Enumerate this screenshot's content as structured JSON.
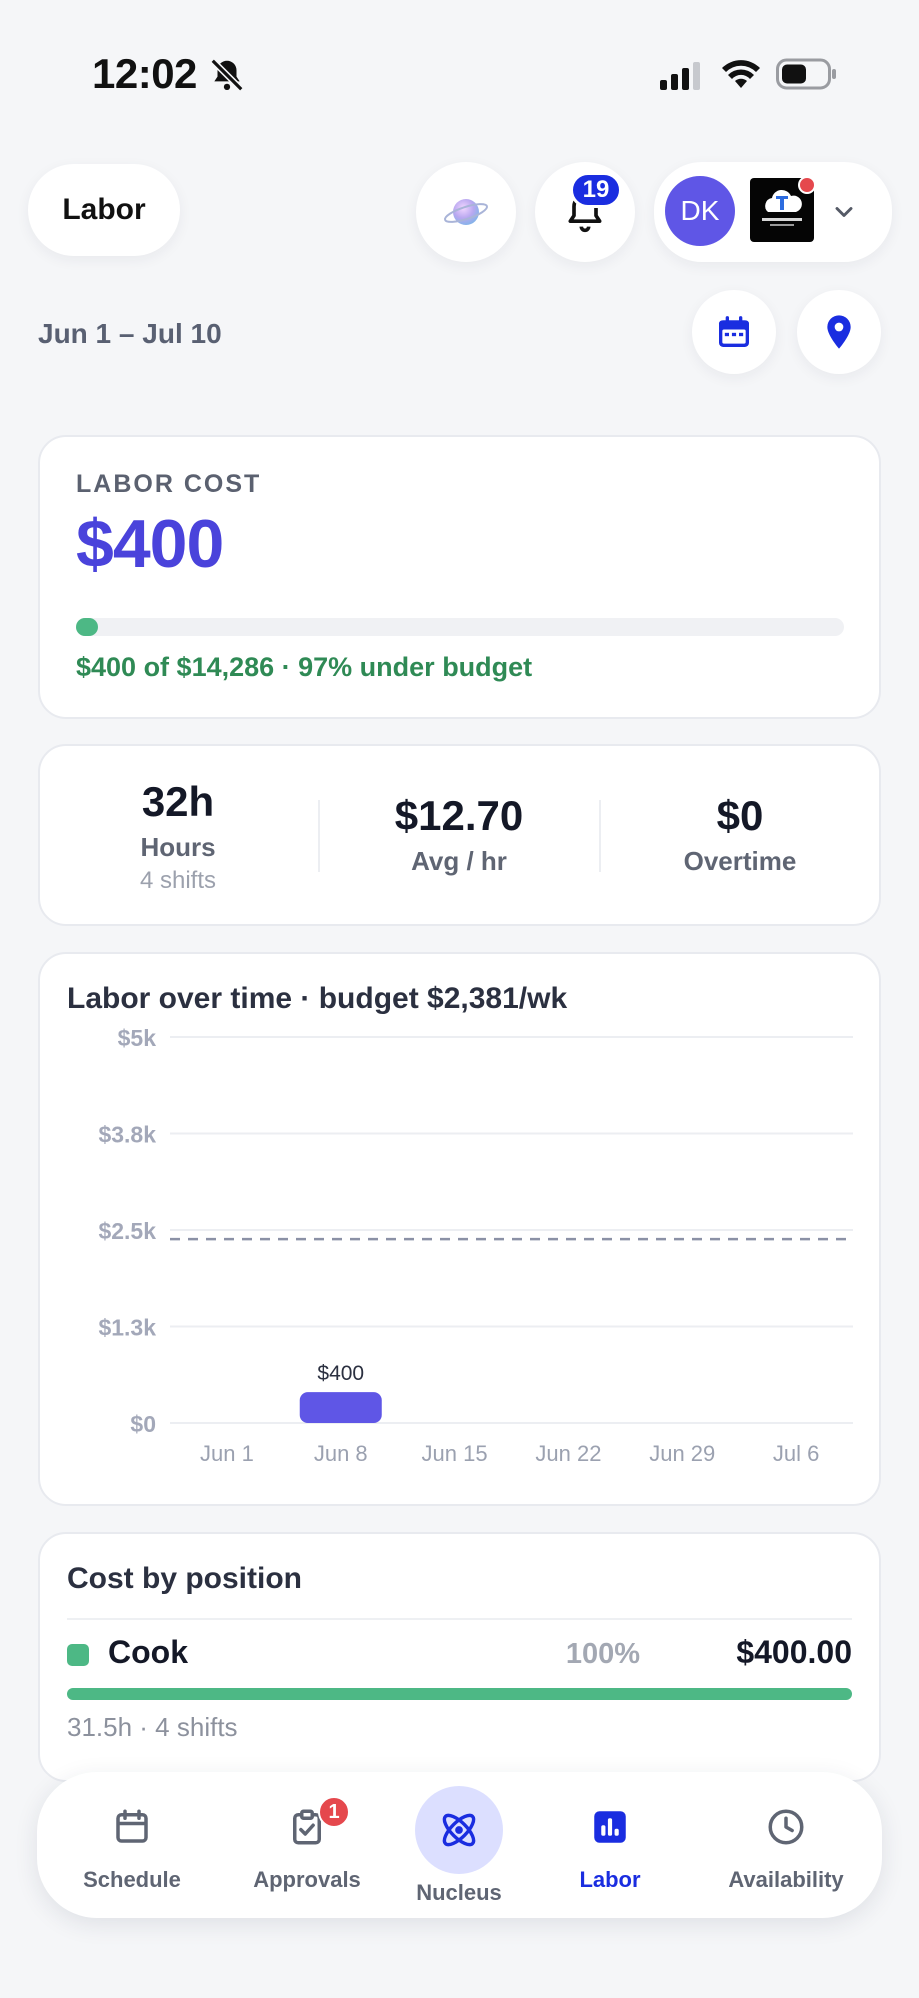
{
  "status_bar": {
    "time": "12:02"
  },
  "header": {
    "title": "Labor",
    "notifications_count": "19",
    "avatar_initials": "DK",
    "org_logo_text": "IRONCLOUD SOLUTION"
  },
  "date_range": "Jun 1 – Jul 10",
  "labor_cost": {
    "label": "LABOR COST",
    "value": "$400",
    "summary": "$400 of $14,286 · 97% under budget",
    "progress_fraction": 0.028
  },
  "stats": [
    {
      "value": "32h",
      "label": "Hours",
      "sub": "4 shifts"
    },
    {
      "value": "$12.70",
      "label": "Avg / hr",
      "sub": ""
    },
    {
      "value": "$0",
      "label": "Overtime",
      "sub": ""
    }
  ],
  "chart_data": {
    "type": "bar",
    "title": "Labor over time · budget $2,381/wk",
    "categories": [
      "Jun 1",
      "Jun 8",
      "Jun 15",
      "Jun 22",
      "Jun 29",
      "Jul 6"
    ],
    "values": [
      0,
      400,
      0,
      0,
      0,
      0
    ],
    "data_labels": [
      "",
      "$400",
      "",
      "",
      "",
      ""
    ],
    "y_ticks": [
      "$5k",
      "$3.8k",
      "$2.5k",
      "$1.3k",
      "$0"
    ],
    "y_tick_values": [
      5000,
      3750,
      2500,
      1250,
      0
    ],
    "ylim": [
      0,
      5000
    ],
    "budget_line": 2381,
    "bar_color": "#5f56e6",
    "grid": true
  },
  "cost_by_position": {
    "title": "Cost by position",
    "items": [
      {
        "name": "Cook",
        "percent": "100%",
        "amount": "$400.00",
        "sub": "31.5h · 4 shifts",
        "fraction": 1.0,
        "color": "#4db885"
      }
    ]
  },
  "nav": {
    "items": [
      {
        "label": "Schedule",
        "icon": "calendar-icon"
      },
      {
        "label": "Approvals",
        "icon": "clipboard-check-icon",
        "badge": "1"
      },
      {
        "label": "Nucleus",
        "icon": "atom-icon"
      },
      {
        "label": "Labor",
        "icon": "bar-chart-icon",
        "active": true
      },
      {
        "label": "Availability",
        "icon": "clock-icon"
      }
    ]
  },
  "colors": {
    "accent": "#4a43db",
    "brand_blue": "#1a2de0",
    "success": "#4db885",
    "badge_red": "#e5484d"
  }
}
